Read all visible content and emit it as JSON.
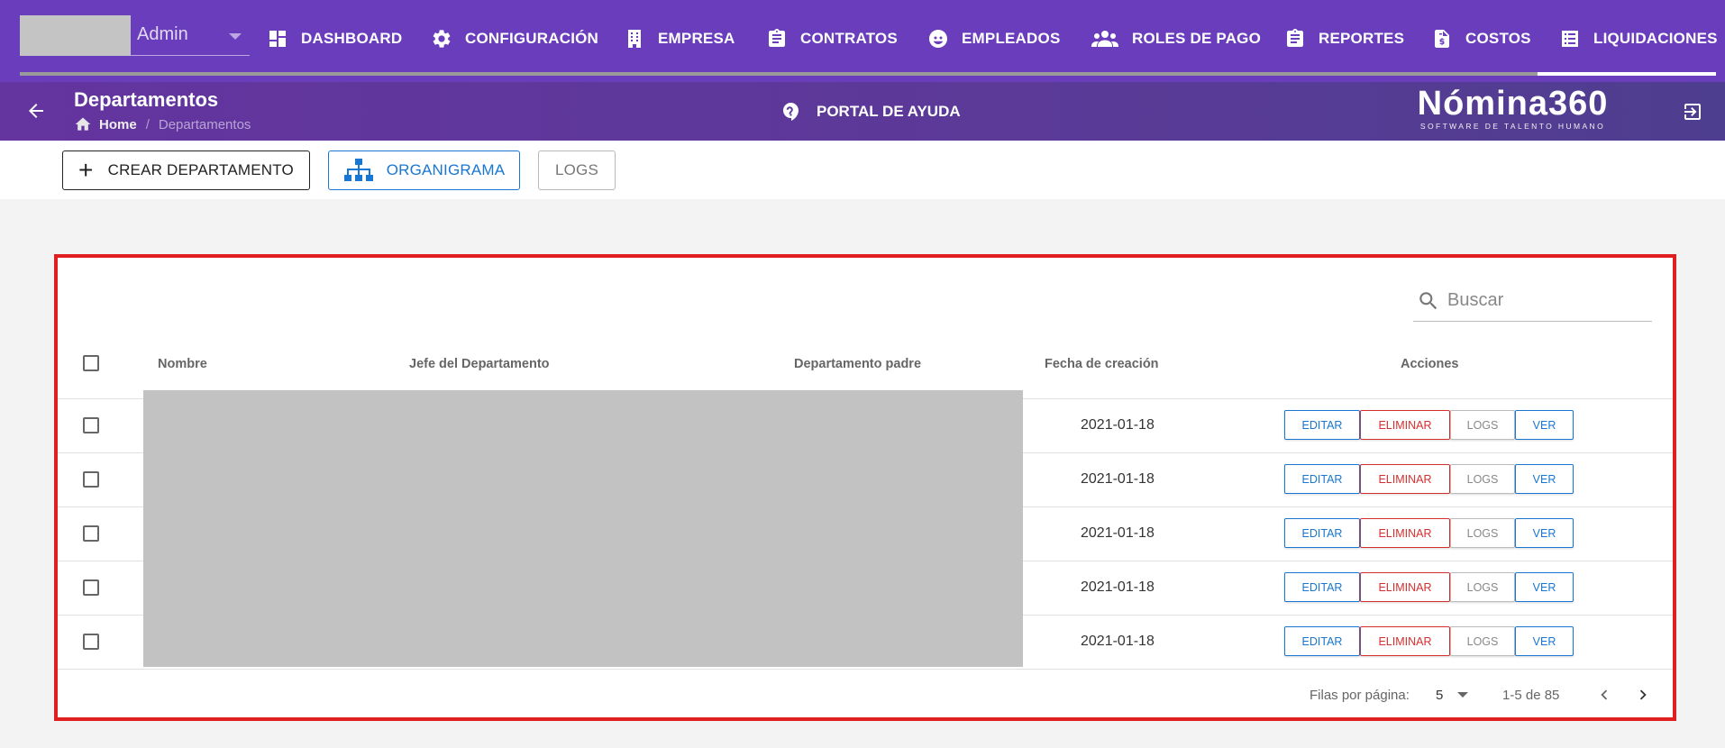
{
  "user": {
    "name": "Admin"
  },
  "nav": {
    "items": [
      {
        "label": "DASHBOARD",
        "icon": "dashboard-icon"
      },
      {
        "label": "CONFIGURACIÓN",
        "icon": "gear-icon"
      },
      {
        "label": "EMPRESA",
        "icon": "building-icon"
      },
      {
        "label": "CONTRATOS",
        "icon": "clipboard-icon"
      },
      {
        "label": "EMPLEADOS",
        "icon": "face-icon"
      },
      {
        "label": "ROLES DE PAGO",
        "icon": "people-icon"
      },
      {
        "label": "REPORTES",
        "icon": "clipboard-icon"
      },
      {
        "label": "COSTOS",
        "icon": "invoice-dollar-icon"
      },
      {
        "label": "LIQUIDACIONES",
        "icon": "list-icon"
      }
    ]
  },
  "header": {
    "title": "Departamentos",
    "breadcrumb_home": "Home",
    "breadcrumb_sep": "/",
    "breadcrumb_current": "Departamentos",
    "help_label": "PORTAL DE AYUDA",
    "brand_name": "Nómina360",
    "brand_tagline": "SOFTWARE DE TALENTO HUMANO"
  },
  "toolbar": {
    "create_label": "CREAR DEPARTAMENTO",
    "create_symbol": "+",
    "org_label": "ORGANIGRAMA",
    "logs_label": "LOGS"
  },
  "table": {
    "search_placeholder": "Buscar",
    "columns": {
      "nombre": "Nombre",
      "jefe": "Jefe del Departamento",
      "padre": "Departamento padre",
      "fecha": "Fecha de creación",
      "acciones": "Acciones"
    },
    "rows": [
      {
        "fecha": "2021-01-18"
      },
      {
        "fecha": "2021-01-18"
      },
      {
        "fecha": "2021-01-18"
      },
      {
        "fecha": "2021-01-18"
      },
      {
        "fecha": "2021-01-18"
      }
    ],
    "actions": {
      "edit": "EDITAR",
      "delete": "ELIMINAR",
      "logs": "LOGS",
      "view": "VER"
    },
    "footer": {
      "rows_per_page_label": "Filas por página:",
      "rows_per_page": "5",
      "range": "1-5 de 85"
    }
  },
  "colors": {
    "nav_bg": "#6a3dbd",
    "primary": "#1976d2",
    "danger": "#d32f2f",
    "highlight_border": "#e02020"
  }
}
